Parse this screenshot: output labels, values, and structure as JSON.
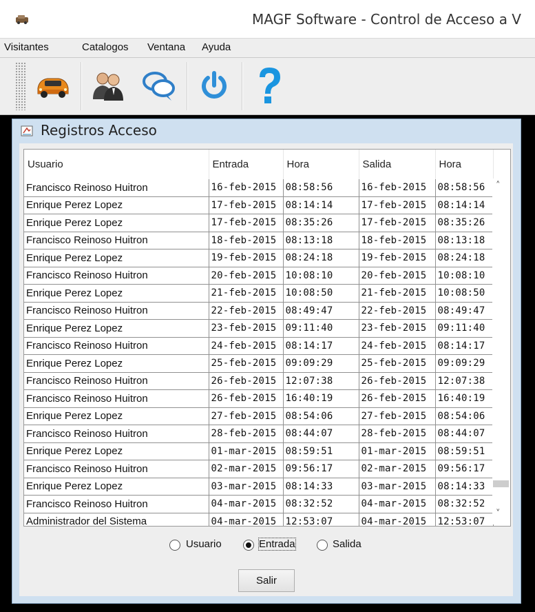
{
  "window": {
    "title": "MAGF Software - Control de Acceso a V"
  },
  "menu": [
    {
      "label": "Visitantes"
    },
    {
      "label": "Catalogos"
    },
    {
      "label": "Ventana"
    },
    {
      "label": "Ayuda"
    }
  ],
  "toolbar": {
    "buttons": [
      {
        "icon": "car-icon"
      },
      {
        "icon": "users-icon"
      },
      {
        "icon": "chat-bubbles-icon"
      },
      {
        "icon": "power-icon"
      },
      {
        "icon": "help-icon"
      }
    ]
  },
  "frame": {
    "title": "Registros Acceso"
  },
  "table": {
    "columns": [
      "Usuario",
      "Entrada",
      "Hora",
      "Salida",
      "Hora"
    ],
    "rows": [
      [
        "Francisco Reinoso Huitron",
        "16-feb-2015",
        "08:58:56",
        "16-feb-2015",
        "08:58:56"
      ],
      [
        "Enrique Perez Lopez",
        "17-feb-2015",
        "08:14:14",
        "17-feb-2015",
        "08:14:14"
      ],
      [
        "Enrique Perez Lopez",
        "17-feb-2015",
        "08:35:26",
        "17-feb-2015",
        "08:35:26"
      ],
      [
        "Francisco Reinoso Huitron",
        "18-feb-2015",
        "08:13:18",
        "18-feb-2015",
        "08:13:18"
      ],
      [
        "Enrique Perez Lopez",
        "19-feb-2015",
        "08:24:18",
        "19-feb-2015",
        "08:24:18"
      ],
      [
        "Francisco Reinoso Huitron",
        "20-feb-2015",
        "10:08:10",
        "20-feb-2015",
        "10:08:10"
      ],
      [
        "Enrique Perez Lopez",
        "21-feb-2015",
        "10:08:50",
        "21-feb-2015",
        "10:08:50"
      ],
      [
        "Francisco Reinoso Huitron",
        "22-feb-2015",
        "08:49:47",
        "22-feb-2015",
        "08:49:47"
      ],
      [
        "Enrique Perez Lopez",
        "23-feb-2015",
        "09:11:40",
        "23-feb-2015",
        "09:11:40"
      ],
      [
        "Francisco Reinoso Huitron",
        "24-feb-2015",
        "08:14:17",
        "24-feb-2015",
        "08:14:17"
      ],
      [
        "Enrique Perez Lopez",
        "25-feb-2015",
        "09:09:29",
        "25-feb-2015",
        "09:09:29"
      ],
      [
        "Francisco Reinoso Huitron",
        "26-feb-2015",
        "12:07:38",
        "26-feb-2015",
        "12:07:38"
      ],
      [
        "Francisco Reinoso Huitron",
        "26-feb-2015",
        "16:40:19",
        "26-feb-2015",
        "16:40:19"
      ],
      [
        "Enrique Perez Lopez",
        "27-feb-2015",
        "08:54:06",
        "27-feb-2015",
        "08:54:06"
      ],
      [
        "Francisco Reinoso Huitron",
        "28-feb-2015",
        "08:44:07",
        "28-feb-2015",
        "08:44:07"
      ],
      [
        "Enrique Perez Lopez",
        "01-mar-2015",
        "08:59:51",
        "01-mar-2015",
        "08:59:51"
      ],
      [
        "Francisco Reinoso Huitron",
        "02-mar-2015",
        "09:56:17",
        "02-mar-2015",
        "09:56:17"
      ],
      [
        "Enrique Perez Lopez",
        "03-mar-2015",
        "08:14:33",
        "03-mar-2015",
        "08:14:33"
      ],
      [
        "Francisco Reinoso Huitron",
        "04-mar-2015",
        "08:32:52",
        "04-mar-2015",
        "08:32:52"
      ],
      [
        "Administrador del Sistema",
        "04-mar-2015",
        "12:53:07",
        "04-mar-2015",
        "12:53:07"
      ]
    ]
  },
  "sort_options": {
    "usuario": "Usuario",
    "entrada": "Entrada",
    "salida": "Salida",
    "selected": "Entrada"
  },
  "buttons": {
    "salir": "Salir"
  }
}
